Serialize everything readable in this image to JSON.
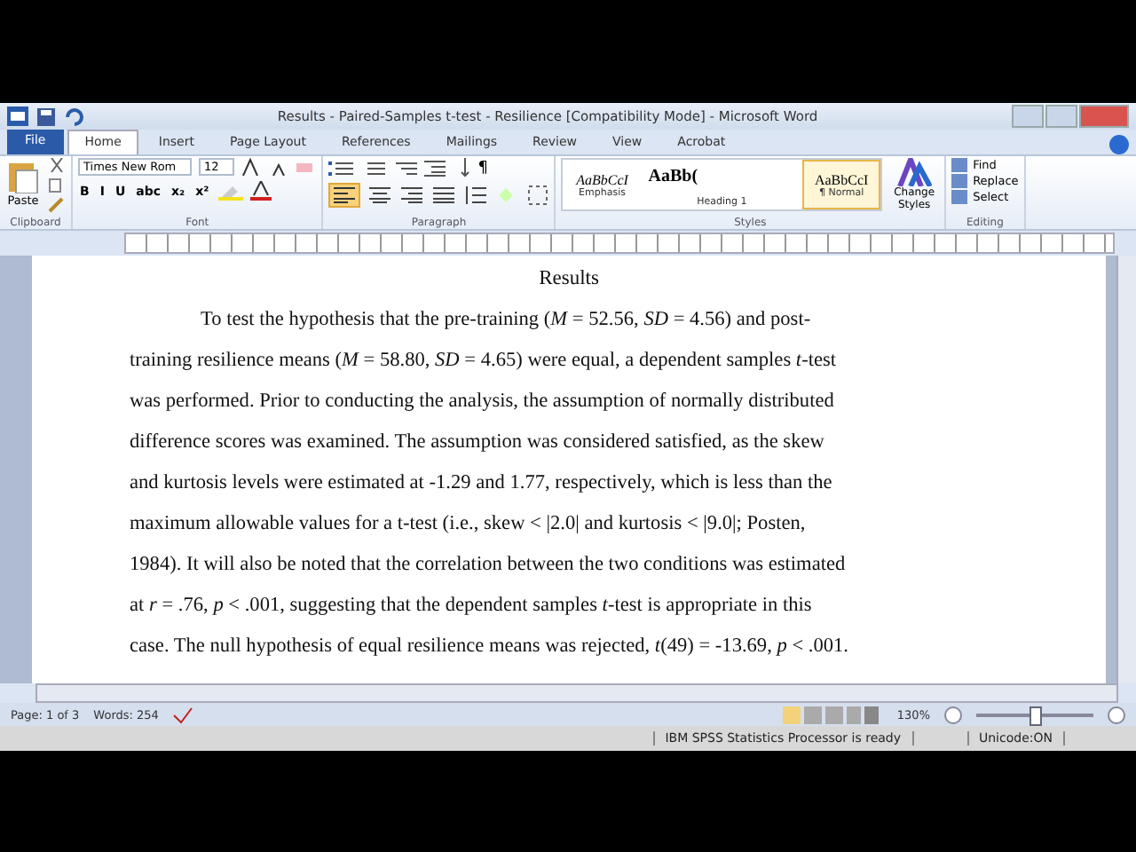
{
  "window": {
    "title": "Results - Paired-Samples t-test - Resilience [Compatibility Mode] - Microsoft Word"
  },
  "tabs": [
    {
      "label": "File",
      "kind": "file",
      "selected": false
    },
    {
      "label": "Home",
      "kind": "tab",
      "selected": true
    },
    {
      "label": "Insert",
      "kind": "tab",
      "selected": false
    },
    {
      "label": "Page Layout",
      "kind": "tab",
      "selected": false
    },
    {
      "label": "References",
      "kind": "tab",
      "selected": false
    },
    {
      "label": "Mailings",
      "kind": "tab",
      "selected": false
    },
    {
      "label": "Review",
      "kind": "tab",
      "selected": false
    },
    {
      "label": "View",
      "kind": "tab",
      "selected": false
    },
    {
      "label": "Acrobat",
      "kind": "tab",
      "selected": false
    }
  ],
  "ribbon": {
    "clipboard": {
      "paste": "Paste",
      "group": "Clipboard"
    },
    "font": {
      "name": "Times New Rom",
      "size": "12",
      "buttons": [
        "B",
        "I",
        "U",
        "abc",
        "x₂",
        "x²"
      ],
      "group": "Font"
    },
    "paragraph": {
      "pilcrow": "¶",
      "group": "Paragraph"
    },
    "styles": {
      "items": [
        {
          "sample": "AaBbCcI",
          "label": "Emphasis",
          "kind": "emphasis",
          "selected": false
        },
        {
          "sample": "AaBb(",
          "label": "Heading 1",
          "kind": "heading",
          "selected": false
        },
        {
          "sample": "AaBbCcI",
          "label": "¶ Normal",
          "kind": "normal",
          "selected": true
        }
      ],
      "change": "Change Styles",
      "group": "Styles"
    },
    "editing": {
      "items": [
        "Find",
        "Replace",
        "Select"
      ],
      "group": "Editing"
    }
  },
  "document": {
    "heading": "Results",
    "lines": [
      "To test the hypothesis that the pre-training (*M* = 52.56, *SD* = 4.56) and post-",
      "training resilience means (*M* = 58.80, *SD* = 4.65) were equal, a dependent samples *t*-test",
      "was performed. Prior to conducting the analysis, the assumption of normally distributed",
      "difference scores was examined. The assumption was considered satisfied, as the skew",
      "and kurtosis levels were estimated at -1.29 and 1.77, respectively, which is less than the",
      "maximum allowable values for a t-test (i.e., skew < |2.0| and kurtosis < |9.0|; Posten,",
      "1984). It will also be noted that the correlation between the two conditions was estimated",
      "at *r* = .76, *p* < .001, suggesting that the dependent samples *t*-test is appropriate in this",
      "case. The null hypothesis of equal resilience means was rejected, *t*(49) = -13.69, *p* < .001."
    ]
  },
  "status_bar": {
    "page": "Page: 1 of 3",
    "words": "Words: 254",
    "zoom": "130%",
    "zoom_slider": {
      "level": 0.5
    }
  },
  "taskbar": {
    "status": "IBM SPSS Statistics Processor is ready",
    "unicode": "Unicode:ON"
  }
}
